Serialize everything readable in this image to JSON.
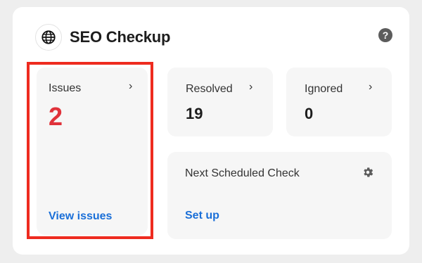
{
  "header": {
    "title": "SEO Checkup",
    "help_glyph": "?",
    "logo_icon": "globe-icon",
    "help_icon": "question-mark-icon"
  },
  "issues": {
    "label": "Issues",
    "count": "2",
    "link": "View issues",
    "accent": "#e0323a"
  },
  "resolved": {
    "label": "Resolved",
    "count": "19"
  },
  "ignored": {
    "label": "Ignored",
    "count": "0"
  },
  "schedule": {
    "label": "Next Scheduled Check",
    "link": "Set up",
    "icon": "gear-icon"
  },
  "chevron_glyph": "›",
  "colors": {
    "highlight": "#ee2b1f",
    "link": "#1a6fd8"
  }
}
